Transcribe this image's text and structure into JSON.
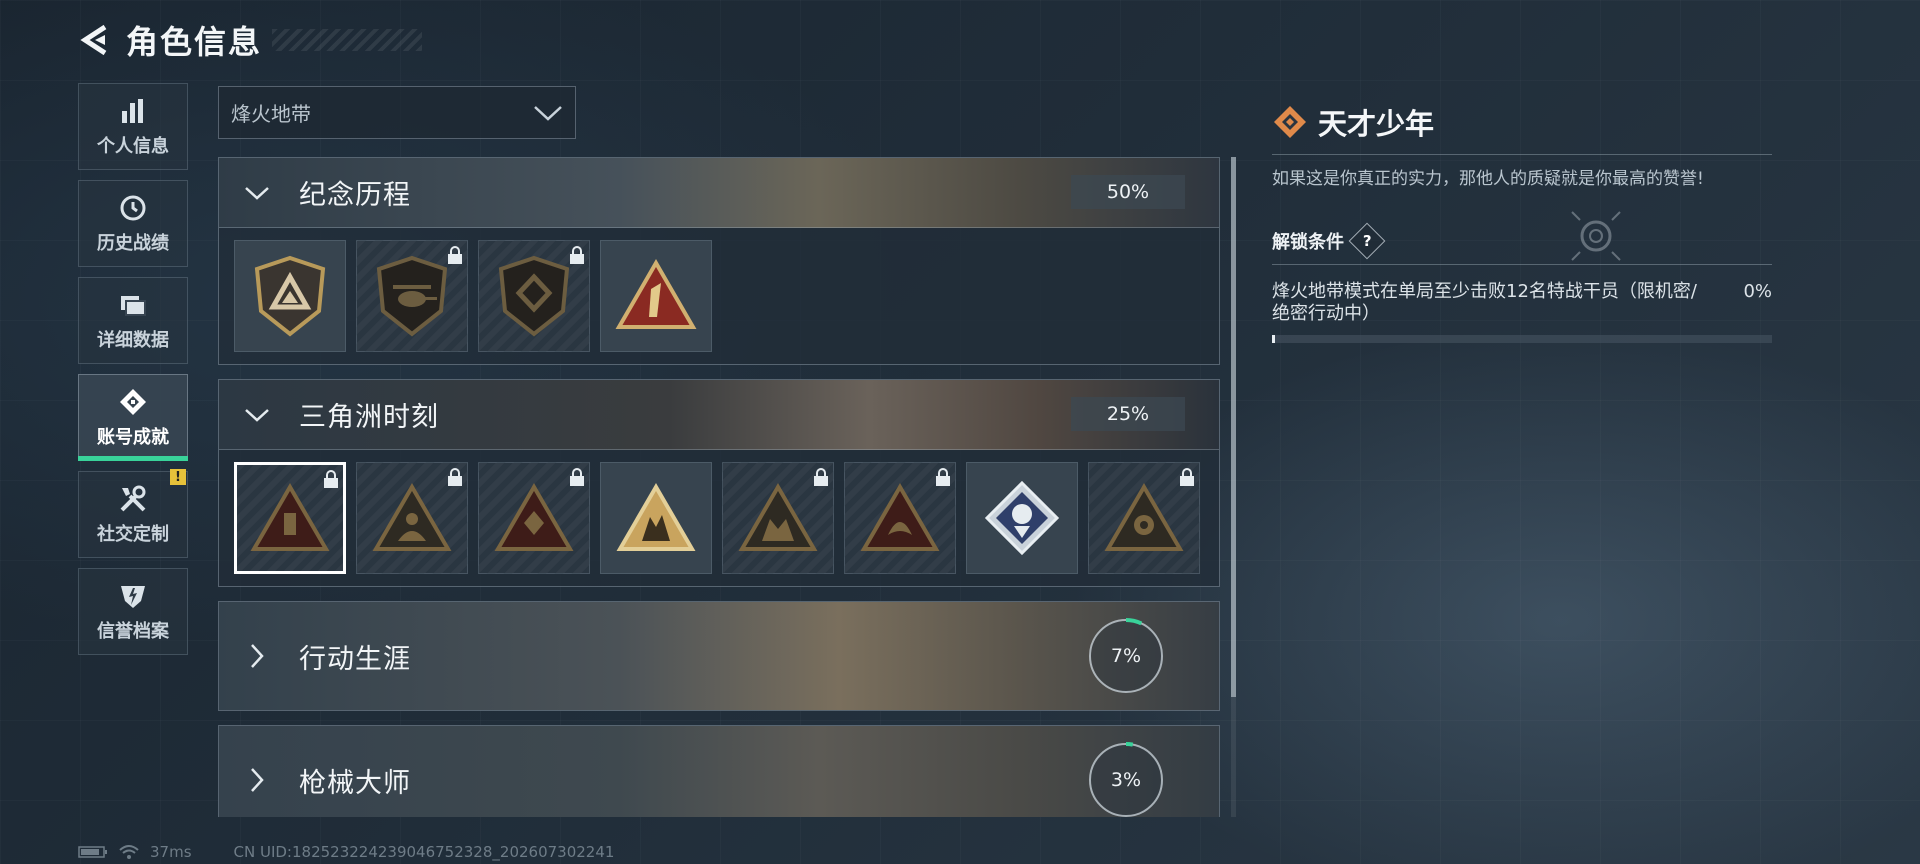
{
  "header": {
    "title": "角色信息",
    "back_icon": "back-arrow-icon"
  },
  "nav": {
    "items": [
      {
        "label": "个人信息",
        "icon": "bar-chart-icon",
        "active": false
      },
      {
        "label": "历史战绩",
        "icon": "clock-icon",
        "active": false
      },
      {
        "label": "详细数据",
        "icon": "folder-icon",
        "active": false
      },
      {
        "label": "账号成就",
        "icon": "achievement-icon",
        "active": true
      },
      {
        "label": "社交定制",
        "icon": "tools-icon",
        "active": false,
        "badge": "!"
      },
      {
        "label": "信誉档案",
        "icon": "shield-icon",
        "active": false
      }
    ]
  },
  "mode_select": {
    "value": "烽火地带"
  },
  "categories": [
    {
      "name": "纪念历程",
      "progress": "50%",
      "expanded": true,
      "medal_count": 4,
      "locked": [
        false,
        true,
        true,
        false
      ]
    },
    {
      "name": "三角洲时刻",
      "progress": "25%",
      "expanded": true,
      "medal_count": 8,
      "locked": [
        true,
        true,
        true,
        false,
        true,
        true,
        false,
        true
      ],
      "selected_index": 0
    },
    {
      "name": "行动生涯",
      "progress": "7%",
      "expanded": false,
      "progress_value": 0.07
    },
    {
      "name": "枪械大师",
      "progress": "3%",
      "expanded": false,
      "progress_value": 0.03
    }
  ],
  "detail": {
    "title": "天才少年",
    "description": "如果这是你真正的实力，那他人的质疑就是你最高的赞誉!",
    "condition_title": "解锁条件",
    "condition_text": "烽火地带模式在单局至少击败12名特战干员（限机密/绝密行动中）",
    "condition_progress": "0%",
    "help_label": "?"
  },
  "footer": {
    "ping": "37ms",
    "uid": "CN UID:1825232242390467523​28_202607302241"
  },
  "colors": {
    "accent_green": "#39d39a",
    "badge_yellow": "#e6c13a",
    "medal_gold": "#b89a5a",
    "title_orange": "#e08a4a"
  }
}
